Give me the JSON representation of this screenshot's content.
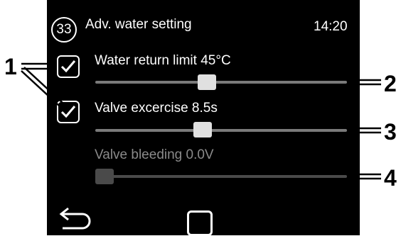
{
  "header": {
    "screen_number": "33",
    "title": "Adv. water setting",
    "time": "14:20"
  },
  "settings": [
    {
      "label": "Water return limit 45°C",
      "checked": true,
      "enabled": true,
      "value_fraction": 0.44
    },
    {
      "label": "Valve excercise 8.5s",
      "checked": true,
      "enabled": true,
      "value_fraction": 0.42
    },
    {
      "label": "Valve bleeding 0.0V",
      "checked": false,
      "enabled": false,
      "value_fraction": 0.0
    }
  ],
  "callouts": [
    "1",
    "2",
    "3",
    "4"
  ],
  "footer": {
    "back_icon": "back-arrow-icon",
    "home_icon": "home-square-icon"
  }
}
